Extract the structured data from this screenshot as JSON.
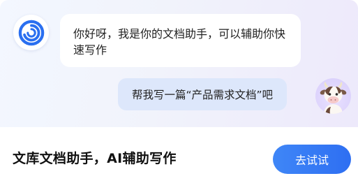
{
  "chat": {
    "assistant_message": "你好呀，我是你的文档助手，可以辅助你快速写作",
    "user_message": "帮我写一篇“产品需求文档”吧"
  },
  "footer": {
    "title": "文库文档助手，AI辅助写作",
    "try_button_label": "去试试"
  },
  "icons": {
    "assistant_avatar": "swirl-logo-icon",
    "user_avatar": "cow-avatar-icon"
  },
  "colors": {
    "accent": "#2e6ff2",
    "user_bubble": "#dde7fb"
  }
}
